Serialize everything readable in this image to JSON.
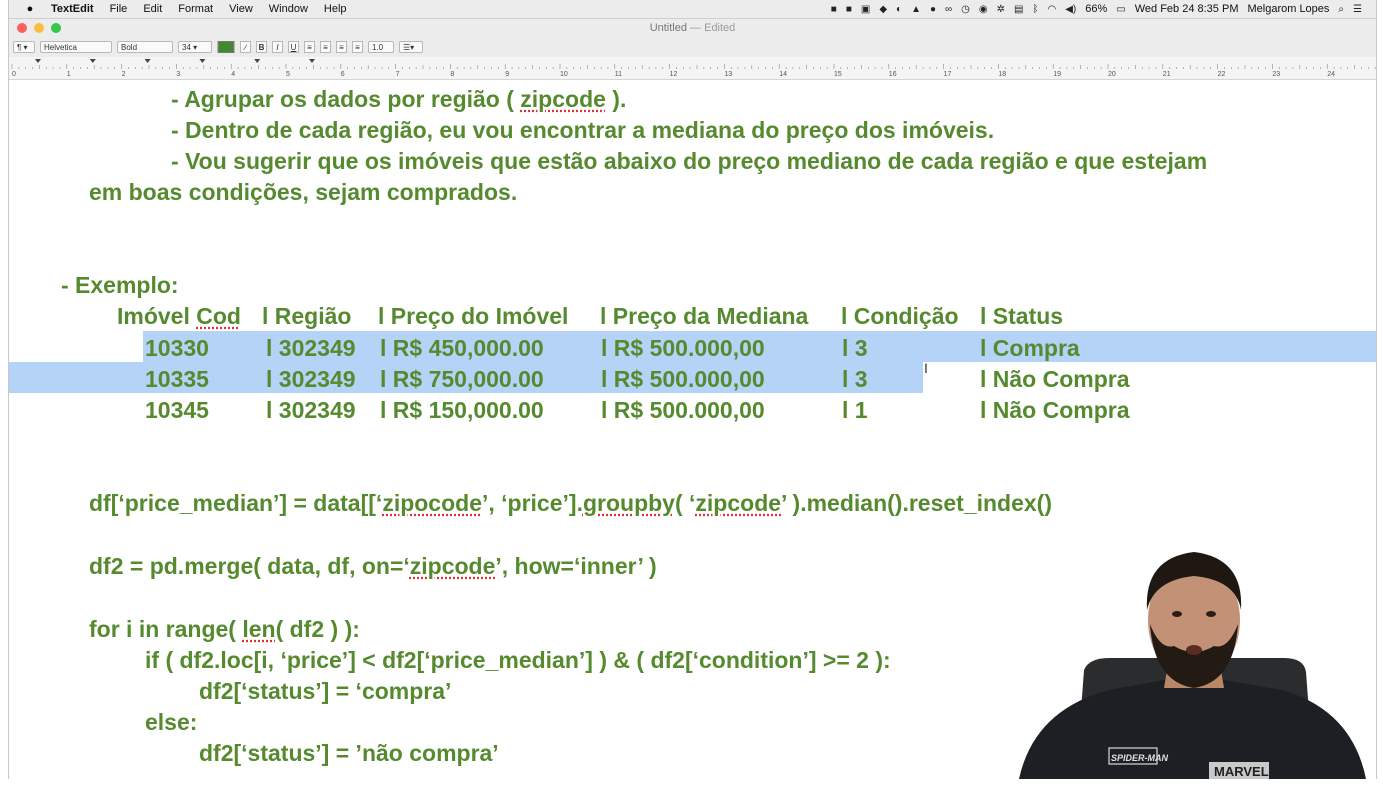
{
  "menubar": {
    "app_name": "TextEdit",
    "items": [
      "File",
      "Edit",
      "Format",
      "View",
      "Window",
      "Help"
    ],
    "battery": "66%",
    "clock": "Wed Feb 24  8:35 PM",
    "user": "Melgarom Lopes"
  },
  "window": {
    "title": "Untitled",
    "edited": "— Edited"
  },
  "toolbar": {
    "paragraph_style": "¶",
    "font_family": "Helvetica",
    "font_style": "Bold",
    "font_size": "34",
    "text_color": "#3f8a2e",
    "line_spacing": "1.0"
  },
  "ruler": {
    "numbers": [
      "0",
      "1",
      "2",
      "3",
      "4",
      "5",
      "6",
      "7",
      "8",
      "9",
      "10",
      "11",
      "12",
      "13",
      "14",
      "15",
      "16",
      "17",
      "18",
      "19",
      "20",
      "21",
      "22",
      "23",
      "24"
    ]
  },
  "doc": {
    "text_color": "#568a2f",
    "steps": [
      "- Agrupar os dados por região ( ",
      "zipcode",
      " ).",
      "- Dentro de cada região, eu vou encontrar a mediana do preço dos imóveis.",
      "- Vou sugerir que os imóveis que estão abaixo do preço mediano de cada região e que estejam",
      "em boas condições, sejam comprados."
    ],
    "example_label": "- Exemplo:",
    "table": {
      "headers": [
        "Imóvel Cod",
        "l Região",
        "l Preço do Imóvel",
        "l Preço da Mediana",
        "l Condição",
        "l Status"
      ],
      "rows": [
        [
          "10330",
          "l 302349",
          "l R$ 450,000.00",
          "l R$ 500.000,00",
          "l 3",
          "l Compra"
        ],
        [
          "10335",
          "l 302349",
          "l R$ 750,000.00",
          "l R$ 500.000,00",
          "l 3",
          "l Não Compra"
        ],
        [
          "10345",
          "l 302349",
          "l R$ 150,000.00",
          "l R$ 500.000,00",
          "l 1",
          "l Não Compra"
        ]
      ]
    },
    "code": {
      "line1_a": "df[‘price_median’] = data[[‘",
      "line1_b": "zipocode",
      "line1_c": "’, ‘price’].",
      "line1_d": "groupby",
      "line1_e": "( ‘",
      "line1_f": "zipcode",
      "line1_g": "’ ).median().reset_index()",
      "line2_a": "df2 = pd.merge( data, df, on=‘",
      "line2_b": "zipcode",
      "line2_c": "’, how=‘inner’ )",
      "line3_a": "for i in range( ",
      "line3_b": "len",
      "line3_c": "( df2 ) ):",
      "line4": "if ( df2.loc[i, ‘price’] < df2[‘price_median’] ) & ( df2[‘condition’] >= 2 ):",
      "line5": "df2[‘status’] = ‘compra’",
      "line6": "else:",
      "line7": "df2[‘status’] = ’não compra’"
    }
  },
  "webcam": {
    "shirt_text": "SPIDER-MAN",
    "shirt_logo": "MARVEL"
  }
}
